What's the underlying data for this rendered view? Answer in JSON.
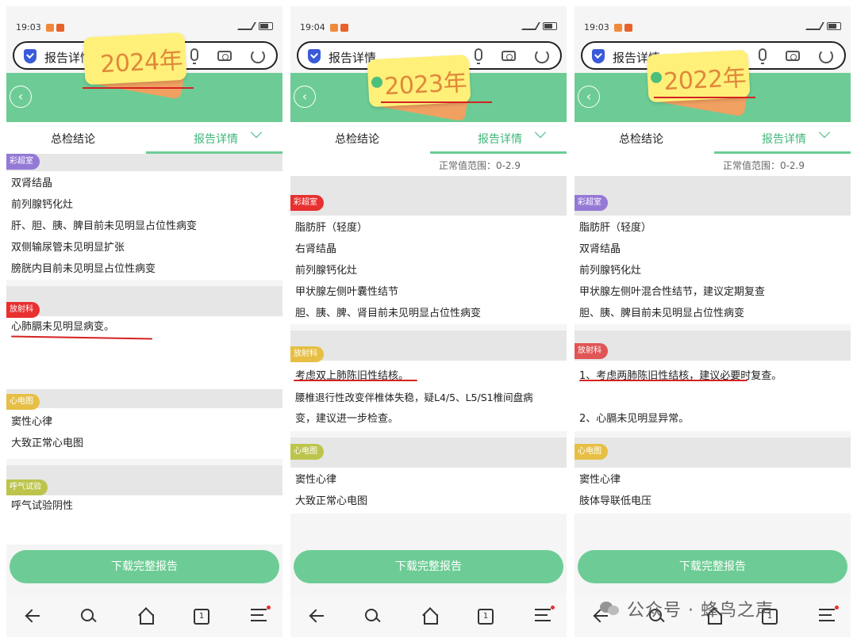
{
  "colors": {
    "accent": "#6dcc95",
    "underline": "#d42222",
    "tag": "#fff07a"
  },
  "phones": [
    {
      "time": "19:03",
      "url_title": "报告详情",
      "year_label": "2024年",
      "tab_left": "总检结论",
      "tab_right": "报告详情",
      "download": "下载完整报告",
      "tabs_count": "1",
      "sections": [
        {
          "label": "彩超室",
          "items": [
            "双肾结晶",
            "前列腺钙化灶",
            "肝、胆、胰、脾目前未见明显占位性病变",
            "双侧输尿管未见明显扩张",
            "膀胱内目前未见明显占位性病变"
          ]
        },
        {
          "label": "放射科",
          "items": [
            "心肺膈未见明显病变。",
            ""
          ]
        },
        {
          "label": "心电图",
          "items": [
            "窦性心律",
            "大致正常心电图"
          ]
        },
        {
          "label": "呼气试验",
          "items": [
            "呼气试验阴性",
            ""
          ]
        }
      ]
    },
    {
      "time": "19:04",
      "url_title": "报告详情",
      "year_label": "2023年",
      "tab_left": "总检结论",
      "tab_right": "报告详情",
      "range_text": "正常值范围：0-2.9",
      "download": "下载完整报告",
      "tabs_count": "1",
      "sections": [
        {
          "label": "彩超室",
          "items": [
            "脂肪肝（轻度）",
            "右肾结晶",
            "前列腺钙化灶",
            "甲状腺左侧叶囊性结节",
            "胆、胰、脾、肾目前未见明显占位性病变"
          ]
        },
        {
          "label": "放射科",
          "items": [
            "考虑双上肺陈旧性结核。",
            "腰椎退行性改变伴椎体失稳，疑L4/5、L5/S1椎间盘病",
            "变，建议进一步检查。"
          ]
        },
        {
          "label": "心电图",
          "items": [
            "窦性心律",
            "大致正常心电图",
            ""
          ]
        }
      ]
    },
    {
      "time": "19:03",
      "url_title": "报告详情",
      "year_label": "2022年",
      "tab_left": "总检结论",
      "tab_right": "报告详情",
      "range_text": "正常值范围：0-2.9",
      "download": "下载完整报告",
      "tabs_count": "1",
      "sections": [
        {
          "label": "彩超室",
          "items": [
            "脂肪肝（轻度）",
            "双肾结晶",
            "前列腺钙化灶",
            "甲状腺左侧叶混合性结节，建议定期复查",
            "胆、胰、脾目前未见明显占位性病变"
          ]
        },
        {
          "label": "放射科",
          "items": [
            "1、考虑两肺陈旧性结核，建议必要时复查。",
            "",
            "2、心膈未见明显异常。"
          ]
        },
        {
          "label": "心电图",
          "items": [
            "窦性心律",
            "肢体导联低电压",
            ""
          ]
        }
      ]
    }
  ],
  "watermark": "公众号 · 蜂鸟之声"
}
